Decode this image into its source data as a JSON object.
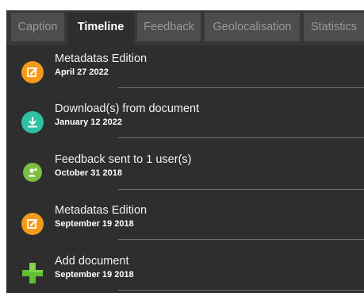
{
  "tabs": [
    {
      "label": "Caption",
      "active": false
    },
    {
      "label": "Timeline",
      "active": true
    },
    {
      "label": "Feedback",
      "active": false
    },
    {
      "label": "Geolocalisation",
      "active": false
    },
    {
      "label": "Statistics",
      "active": false
    }
  ],
  "timeline": [
    {
      "title": "Metadatas Edition",
      "date": "April 27 2022",
      "icon": "edit-icon",
      "color": "#f39a1b"
    },
    {
      "title": "Download(s) from document",
      "date": "January 12 2022",
      "icon": "download-icon",
      "color": "#2fc1a3"
    },
    {
      "title": "Feedback sent to 1 user(s)",
      "date": "October 31 2018",
      "icon": "user-add-icon",
      "color": "#7dbd42"
    },
    {
      "title": "Metadatas Edition",
      "date": "September 19 2018",
      "icon": "edit-icon",
      "color": "#f39a1b"
    },
    {
      "title": "Add document",
      "date": "September 19 2018",
      "icon": "plus-icon",
      "color": "#5fbf2f"
    }
  ]
}
